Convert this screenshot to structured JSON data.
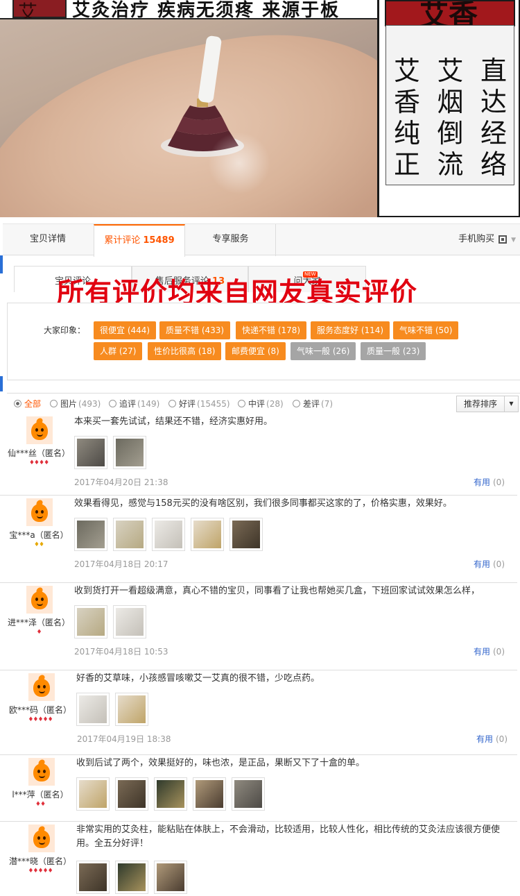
{
  "banner": {
    "strip_char": "艾",
    "strip_text": "艾灸治疗 疾病无须疼 来源于板",
    "right_top": "艾香",
    "columns": [
      [
        "艾",
        "香",
        "纯",
        "正"
      ],
      [
        "艾",
        "烟",
        "倒",
        "流"
      ],
      [
        "直",
        "达",
        "经",
        "络"
      ]
    ]
  },
  "tabs": {
    "items": [
      "宝贝详情",
      "累计评论",
      "专享服务"
    ],
    "review_count": "15489",
    "mobile_buy": "手机购买"
  },
  "subtabs": {
    "items": [
      "宝贝评论",
      "售后服务评论",
      "问大家"
    ],
    "aftersale_count": "13",
    "new_badge": "NEW"
  },
  "overlay_text": "所有评价均来自网友真实评价",
  "impressions": {
    "label": "大家印象：",
    "tags": [
      {
        "text": "很便宜 (444)",
        "color": "#f78b1f"
      },
      {
        "text": "质量不错 (433)",
        "color": "#f78b1f"
      },
      {
        "text": "快递不错 (178)",
        "color": "#f78b1f"
      },
      {
        "text": "服务态度好 (114)",
        "color": "#f78b1f"
      },
      {
        "text": "气味不错 (50)",
        "color": "#f78b1f"
      },
      {
        "text": "人群 (27)",
        "color": "#f78b1f"
      },
      {
        "text": "性价比很高 (18)",
        "color": "#f78b1f"
      },
      {
        "text": "邮费便宜 (8)",
        "color": "#f78b1f"
      },
      {
        "text": "气味一般 (26)",
        "color": "#a5a5a5"
      },
      {
        "text": "质量一般 (23)",
        "color": "#a5a5a5"
      }
    ]
  },
  "filters": {
    "items": [
      {
        "label": "全部",
        "count": ""
      },
      {
        "label": "图片",
        "count": "(493)"
      },
      {
        "label": "追评",
        "count": "(149)"
      },
      {
        "label": "好评",
        "count": "(15455)"
      },
      {
        "label": "中评",
        "count": "(28)"
      },
      {
        "label": "差评",
        "count": "(7)"
      }
    ],
    "sort_label": "推荐排序"
  },
  "reviews": [
    {
      "user": "仙***丝（匿名）",
      "badges": "♦♦♦♦",
      "badge_color": "red",
      "text": "本来买一套先试试，结果还不错，经济实惠好用。",
      "thumbs": 2,
      "date": "2017年04月20日 21:38",
      "useful_label": "有用",
      "useful_count": "(0)"
    },
    {
      "user": "宝***a（匿名）",
      "badges": "♦♦",
      "badge_color": "gold",
      "text": "效果看得见，感觉与158元买的没有啥区别，我们很多同事都买这家的了，价格实惠，效果好。",
      "thumbs": 5,
      "date": "2017年04月18日 20:17",
      "useful_label": "有用",
      "useful_count": "(0)"
    },
    {
      "user": "进***泽（匿名）",
      "badges": "♦",
      "badge_color": "red",
      "text": "收到货打开一看超级满意，真心不错的宝贝，同事看了让我也帮她买几盒，下班回家试试效果怎么样，",
      "thumbs": 2,
      "date": "2017年04月18日 10:53",
      "useful_label": "有用",
      "useful_count": "(0)"
    },
    {
      "user": "欧***码（匿名）",
      "badges": "♦♦♦♦♦",
      "badge_color": "red",
      "text": "好香的艾草味，小孩感冒咳嗽艾一艾真的很不错，少吃点药。",
      "thumbs": 2,
      "date": "2017年04月19日 18:38",
      "useful_label": "有用",
      "useful_count": "(0)"
    },
    {
      "user": "l***萍（匿名）",
      "badges": "♦♦",
      "badge_color": "red",
      "text": "收到后试了两个，效果挺好的，味也浓，是正品，果断又下了十盒的单。",
      "thumbs": 5,
      "date": "",
      "useful_label": "",
      "useful_count": ""
    },
    {
      "user": "潜***晓（匿名）",
      "badges": "♦♦♦♦♦",
      "badge_color": "red",
      "text": "非常实用的艾灸柱，能粘贴在体肤上，不会滑动，比较适用，比较人性化，相比传统的艾灸法应该很方便使用。全五分好评！",
      "thumbs": 3,
      "date": "",
      "useful_label": "",
      "useful_count": ""
    }
  ]
}
